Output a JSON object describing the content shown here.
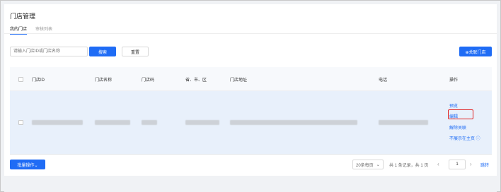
{
  "page": {
    "title": "门店管理"
  },
  "tabs": [
    {
      "label": "我的门店",
      "active": true
    },
    {
      "label": "审核列表",
      "active": false
    }
  ],
  "filters": {
    "search_placeholder": "请输入门店ID或门店名称",
    "search_button": "搜索",
    "reset_button": "重置",
    "link_store_button": "⊕关联门店"
  },
  "table": {
    "columns": [
      "门店ID",
      "门店名称",
      "门店码",
      "省、市、区",
      "门店地址",
      "电话",
      "操作"
    ],
    "rows": [
      {
        "operations": [
          "预览",
          "编辑",
          "解除关联",
          "不展示在主页 ⓘ"
        ]
      }
    ]
  },
  "footer": {
    "batch_button": "批量操作⌄",
    "page_size": "20条每页",
    "summary": "共 1 条记录，共 1 页",
    "current_page": "1",
    "jump_label": "跳转"
  },
  "colors": {
    "primary": "#1f6cf5",
    "highlight_border": "#e02020",
    "row_selected_bg": "#e8f0fb"
  }
}
